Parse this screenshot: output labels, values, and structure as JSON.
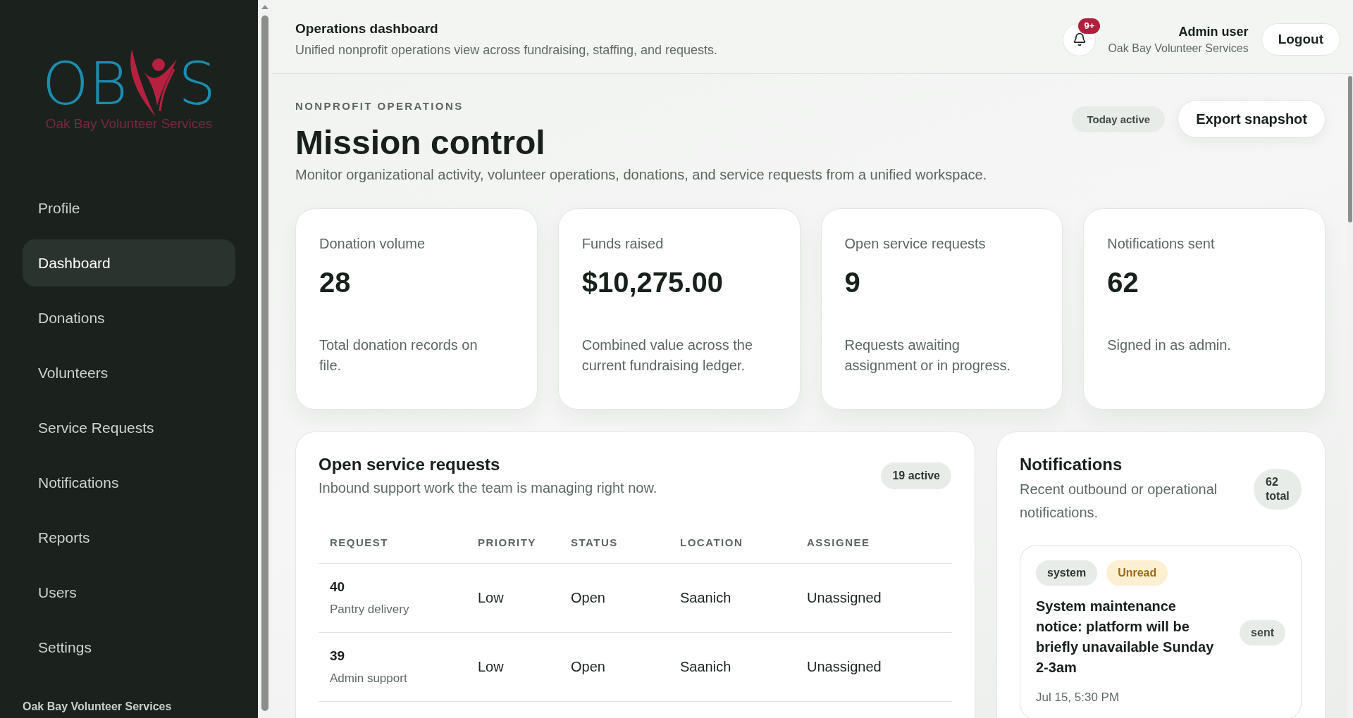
{
  "sidebar": {
    "logo": {
      "letters_left": "OB",
      "letters_right": "S",
      "tagline": "Oak Bay Volunteer Services"
    },
    "nav": [
      {
        "label": "Profile",
        "selected": false
      },
      {
        "label": "Dashboard",
        "selected": true
      },
      {
        "label": "Donations",
        "selected": false
      },
      {
        "label": "Volunteers",
        "selected": false
      },
      {
        "label": "Service Requests",
        "selected": false
      },
      {
        "label": "Notifications",
        "selected": false
      },
      {
        "label": "Reports",
        "selected": false
      },
      {
        "label": "Users",
        "selected": false
      },
      {
        "label": "Settings",
        "selected": false
      }
    ],
    "footer": "Oak Bay Volunteer Services"
  },
  "header": {
    "title": "Operations dashboard",
    "subtitle": "Unified nonprofit operations view across fundraising, staffing, and requests.",
    "notification_count": "9+",
    "user_name": "Admin user",
    "organization": "Oak Bay Volunteer Services",
    "logout": "Logout"
  },
  "hero": {
    "eyebrow": "NONPROFIT OPERATIONS",
    "title": "Mission control",
    "description": "Monitor organizational activity, volunteer operations, donations, and service requests from a unified workspace.",
    "status": "Today active",
    "export_button": "Export snapshot"
  },
  "stats": [
    {
      "label": "Donation volume",
      "value": "28",
      "description": "Total donation records on file."
    },
    {
      "label": "Funds raised",
      "value": "$10,275.00",
      "description": "Combined value across the current fundraising ledger."
    },
    {
      "label": "Open service requests",
      "value": "9",
      "description": "Requests awaiting assignment or in progress."
    },
    {
      "label": "Notifications sent",
      "value": "62",
      "description": "Signed in as admin."
    }
  ],
  "requests_panel": {
    "title": "Open service requests",
    "subtitle": "Inbound support work the team is managing right now.",
    "count": "19 active",
    "columns": [
      "REQUEST",
      "PRIORITY",
      "STATUS",
      "LOCATION",
      "ASSIGNEE"
    ],
    "rows": [
      {
        "id": "40",
        "type": "Pantry delivery",
        "priority": "Low",
        "status": "Open",
        "location": "Saanich",
        "assignee": "Unassigned"
      },
      {
        "id": "39",
        "type": "Admin support",
        "priority": "Low",
        "status": "Open",
        "location": "Saanich",
        "assignee": "Unassigned"
      }
    ]
  },
  "notifications_panel": {
    "title": "Notifications",
    "subtitle": "Recent outbound or operational notifications.",
    "count": "62 total",
    "items": [
      {
        "tags": [
          {
            "label": "system",
            "kind": "category"
          },
          {
            "label": "Unread",
            "kind": "unread"
          }
        ],
        "message": "System maintenance notice: platform will be briefly unavailable Sunday 2-3am",
        "delivery": "sent",
        "time": "Jul 15, 5:30 PM"
      }
    ]
  }
}
